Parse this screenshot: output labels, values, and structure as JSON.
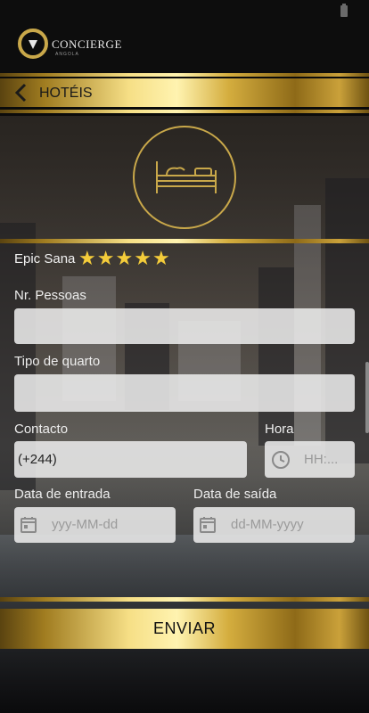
{
  "brand": {
    "name": "CONCIERGE",
    "subtitle": "ANGOLA"
  },
  "nav": {
    "title": "HOTÉIS"
  },
  "hotel": {
    "name": "Epic Sana",
    "rating": 5
  },
  "form": {
    "people_label": "Nr. Pessoas",
    "people_value": "",
    "room_label": "Tipo de quarto",
    "room_value": "",
    "contact_label": "Contacto",
    "contact_value": "(+244)",
    "time_label": "Hora",
    "time_placeholder": "HH:...",
    "checkin_label": "Data de entrada",
    "checkin_placeholder": "yyy-MM-dd",
    "checkout_label": "Data de saída",
    "checkout_placeholder": "dd-MM-yyyy"
  },
  "submit_label": "ENVIAR",
  "colors": {
    "gold": "#c9a84a",
    "star": "#f4cc3a",
    "field_bg": "#ebebeb"
  },
  "icons": [
    "back-chevron-icon",
    "bed-icon",
    "star-icon",
    "clock-icon",
    "calendar-icon"
  ]
}
